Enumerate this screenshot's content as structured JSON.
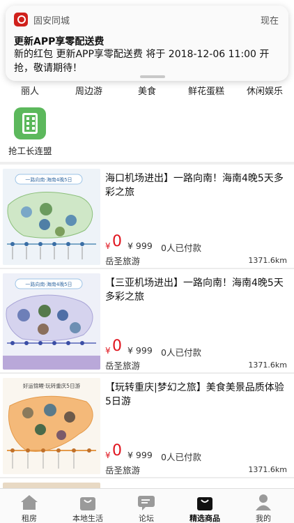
{
  "notification": {
    "app_name": "固安同城",
    "time": "现在",
    "title": "更新APP享零配送费",
    "body": "新的红包 更新APP享零配送费 将于 2018-12-06 11:00 开抢，敬请期待！"
  },
  "categories": [
    "丽人",
    "周边游",
    "美食",
    "鲜花蛋糕",
    "休闲娱乐"
  ],
  "app_tile": {
    "label": "抢工长连盟",
    "icon": "building-icon",
    "color": "#5cb85c"
  },
  "listings": [
    {
      "title": "海口机场进出】一路向南！海南4晚5天多彩之旅",
      "currency": "¥",
      "price": "0",
      "original_price": "¥ 999",
      "paid": "0人已付款",
      "shop": "岳圣旅游",
      "distance": "1371.6km",
      "thumb_caption": "一路向南·海南4晚5日"
    },
    {
      "title": "【三亚机场进出】一路向南！海南4晚5天多彩之旅",
      "currency": "¥",
      "price": "0",
      "original_price": "¥ 999",
      "paid": "0人已付款",
      "shop": "岳圣旅游",
      "distance": "1371.6km",
      "thumb_caption": "一路向南·海南4晚5日"
    },
    {
      "title": "【玩转重庆|梦幻之旅】美食美景品质体验5日游",
      "currency": "¥",
      "price": "0",
      "original_price": "¥ 999",
      "paid": "0人已付款",
      "shop": "岳圣旅游",
      "distance": "1371.6km",
      "thumb_caption": "好运锦鲤·玩转重庆5日游"
    }
  ],
  "tabbar": [
    {
      "label": "租房",
      "icon": "house-icon"
    },
    {
      "label": "本地生活",
      "icon": "bag-icon"
    },
    {
      "label": "论坛",
      "icon": "chat-icon"
    },
    {
      "label": "精选商品",
      "icon": "shopping-bag-icon",
      "active": true
    },
    {
      "label": "我的",
      "icon": "person-icon"
    }
  ],
  "colors": {
    "price": "#e0141e",
    "app_tile": "#5cb85c",
    "notif_icon": "#d0211c"
  }
}
